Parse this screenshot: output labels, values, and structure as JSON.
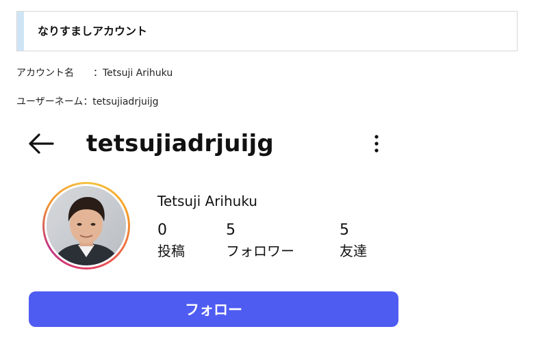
{
  "article": {
    "heading": "なりすましアカウント",
    "account_name_label": "アカウント名",
    "account_name_value": "：Tetsuji Arihuku",
    "username_label": "ユーザーネーム",
    "username_value": "：tetsujiadrjuijg"
  },
  "profile": {
    "handle": "tetsujiadrjuijg",
    "display_name": "Tetsuji Arihuku",
    "stats": {
      "posts": {
        "value": "0",
        "label": "投稿"
      },
      "followers": {
        "value": "5",
        "label": "フォロワー"
      },
      "friends": {
        "value": "5",
        "label": "友達"
      }
    },
    "follow_button_label": "フォロー",
    "icons": {
      "back": "arrow-left-icon",
      "more": "more-vertical-icon"
    }
  },
  "colors": {
    "accent_bar": "#cfe5f6",
    "follow_button": "#4f5cf2",
    "story_ring_start": "#f5c242",
    "story_ring_end": "#c13584"
  }
}
